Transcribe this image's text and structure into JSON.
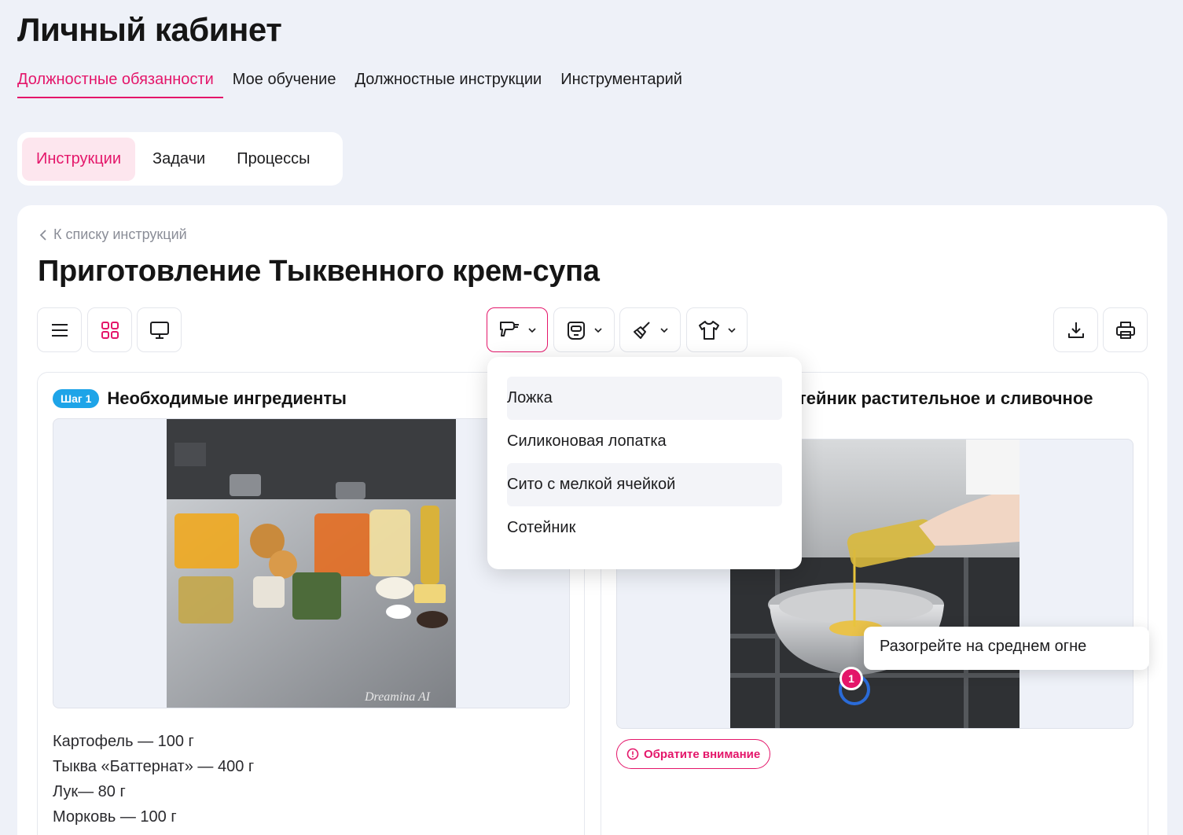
{
  "page": {
    "title": "Личный кабинет"
  },
  "main_tabs": [
    {
      "label": "Должностные обязанности",
      "active": true
    },
    {
      "label": "Мое обучение"
    },
    {
      "label": "Должностные инструкции"
    },
    {
      "label": "Инструментарий"
    }
  ],
  "sub_tabs": [
    {
      "label": "Инструкции",
      "active": true
    },
    {
      "label": "Задачи"
    },
    {
      "label": "Процессы"
    }
  ],
  "card": {
    "back_link": "К списку инструкций",
    "title": "Приготовление Тыквенного крем-супа"
  },
  "toolbar": {
    "view_icons": [
      "list-icon",
      "grid-icon",
      "monitor-icon"
    ],
    "filter_icons": [
      "hand-mixer-icon",
      "welding-mask-icon",
      "broom-icon",
      "tshirt-icon"
    ],
    "action_icons": [
      "download-icon",
      "print-icon"
    ]
  },
  "step1": {
    "badge": "Шаг 1",
    "title": "Необходимые ингредиенты",
    "image_watermark": "Dreamina AI",
    "ingredients": [
      "Картофель — 100 г",
      "Тыква «Баттернат» — 400 г",
      "Лук— 80 г",
      "Морковь — 100 г"
    ]
  },
  "step2": {
    "title_visible": "тейник растительное и сливочное",
    "attention_label": "Обратите внимание"
  },
  "tooltip": {
    "text": "Разогрейте на среднем огне"
  },
  "marker": {
    "number": "1"
  },
  "dropdown": {
    "items": [
      {
        "label": "Ложка",
        "highlighted": true
      },
      {
        "label": "Силиконовая лопатка"
      },
      {
        "label": "Сито с мелкой ячейкой",
        "highlighted": true
      },
      {
        "label": "Сотейник"
      }
    ]
  },
  "colors": {
    "accent": "#e4166a",
    "badge": "#1ea4e8",
    "background": "#eef1f8"
  }
}
